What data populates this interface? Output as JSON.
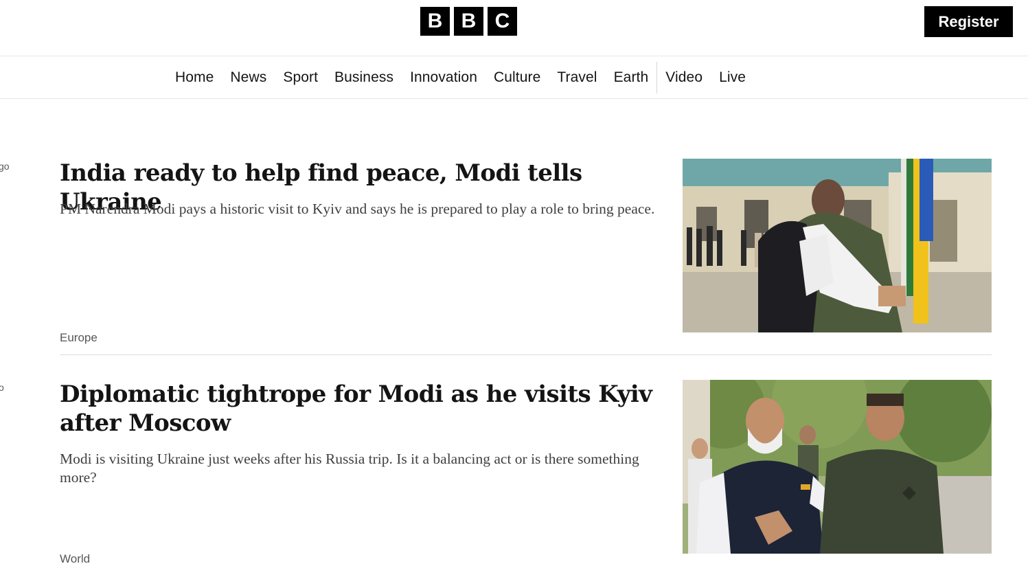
{
  "header": {
    "logo_letters": [
      "B",
      "B",
      "C"
    ],
    "register_label": "Register"
  },
  "nav": {
    "items": [
      "Home",
      "News",
      "Sport",
      "Business",
      "Innovation",
      "Culture",
      "Travel",
      "Earth",
      "Video",
      "Live"
    ]
  },
  "edge_fragments": [
    "go",
    "o"
  ],
  "articles": [
    {
      "headline": "India ready to help find peace, Modi tells Ukraine",
      "summary": "PM Narendra Modi pays a historic visit to Kyiv and says he is prepared to play a role to bring peace.",
      "tag": "Europe",
      "image": "modi-zelensky-hug-photo"
    },
    {
      "headline": "Diplomatic tightrope for Modi as he visits Kyiv after Moscow",
      "summary": "Modi is visiting Ukraine just weeks after his Russia trip. Is it a balancing act or is there something more?",
      "tag": "World",
      "image": "modi-zelensky-walking-photo"
    }
  ],
  "colors": {
    "brand_black": "#000000",
    "text": "#141414",
    "meta": "#545658"
  }
}
